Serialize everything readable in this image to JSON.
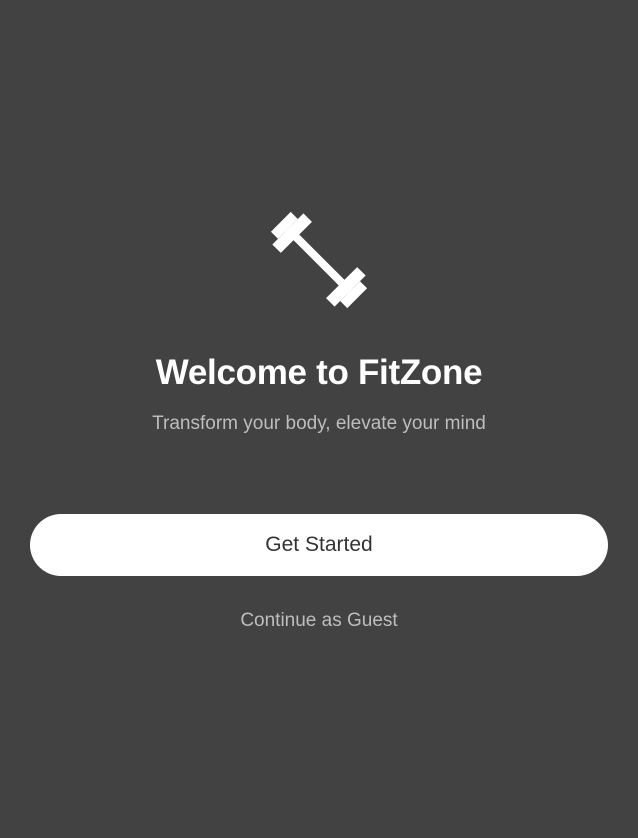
{
  "welcome": {
    "logo_icon": "dumbbell-icon",
    "title": "Welcome to FitZone",
    "subtitle": "Transform your body, elevate your mind"
  },
  "actions": {
    "primary_label": "Get Started",
    "secondary_label": "Continue as Guest"
  },
  "colors": {
    "background": "#424242",
    "title": "#ffffff",
    "muted_text": "#bdbdbd",
    "button_bg": "#ffffff",
    "button_text": "#333333"
  }
}
